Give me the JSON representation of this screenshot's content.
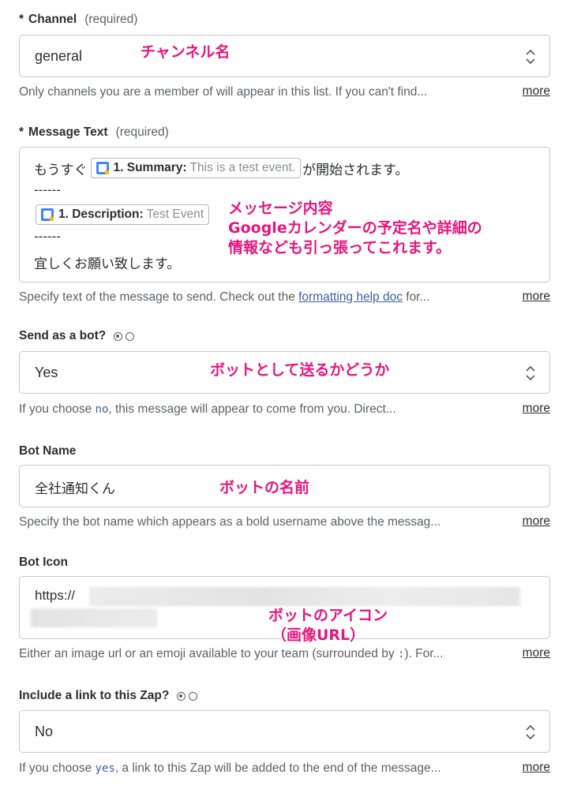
{
  "channel": {
    "label": "Channel",
    "required": "(required)",
    "value": "general",
    "help": "Only channels you are a member of will appear in this list. If you can't find...",
    "more": "more",
    "annotation": "チャンネル名"
  },
  "message_text": {
    "label": "Message Text",
    "required": "(required)",
    "line1_prefix": "もうすぐ",
    "pill1_key": "1. Summary:",
    "pill1_example": "This is a test event.",
    "line1_suffix": "が開始されます。",
    "dashes1": "------",
    "pill2_key": "1. Description:",
    "pill2_example": "Test Event",
    "dashes2": "------",
    "line_last": "宜しくお願い致します。",
    "help_prefix": "Specify text of the message to send. Check out the ",
    "help_link": "formatting help doc",
    "help_suffix": " for...",
    "more": "more",
    "annotation_1": "メッセージ内容",
    "annotation_2": "Googleカレンダーの予定名や詳細の",
    "annotation_3": "情報なども引っ張ってこれます。"
  },
  "send_as_bot": {
    "label": "Send as a bot?",
    "value": "Yes",
    "help_prefix": "If you choose ",
    "help_code": "no",
    "help_suffix": ", this message will appear to come from you. Direct...",
    "more": "more",
    "annotation": "ボットとして送るかどうか"
  },
  "bot_name": {
    "label": "Bot Name",
    "value": "全社通知くん",
    "help": "Specify the bot name which appears as a bold username above the messag...",
    "more": "more",
    "annotation": "ボットの名前"
  },
  "bot_icon": {
    "label": "Bot Icon",
    "value_prefix": "https://",
    "help_prefix": "Either an image url or an emoji available to your team (surrounded by ",
    "help_code": ":",
    "help_suffix": "). For...",
    "more": "more",
    "annotation_1": "ボットのアイコン",
    "annotation_2": "（画像URL）"
  },
  "include_link": {
    "label": "Include a link to this Zap?",
    "value": "No",
    "help_prefix": "If you choose ",
    "help_code": "yes",
    "help_suffix": ", a link to this Zap will be added to the end of the message...",
    "more": "more"
  },
  "colors": {
    "annotation": "#e8157e",
    "link": "#3e5fa8",
    "border": "#c8c9cb"
  }
}
